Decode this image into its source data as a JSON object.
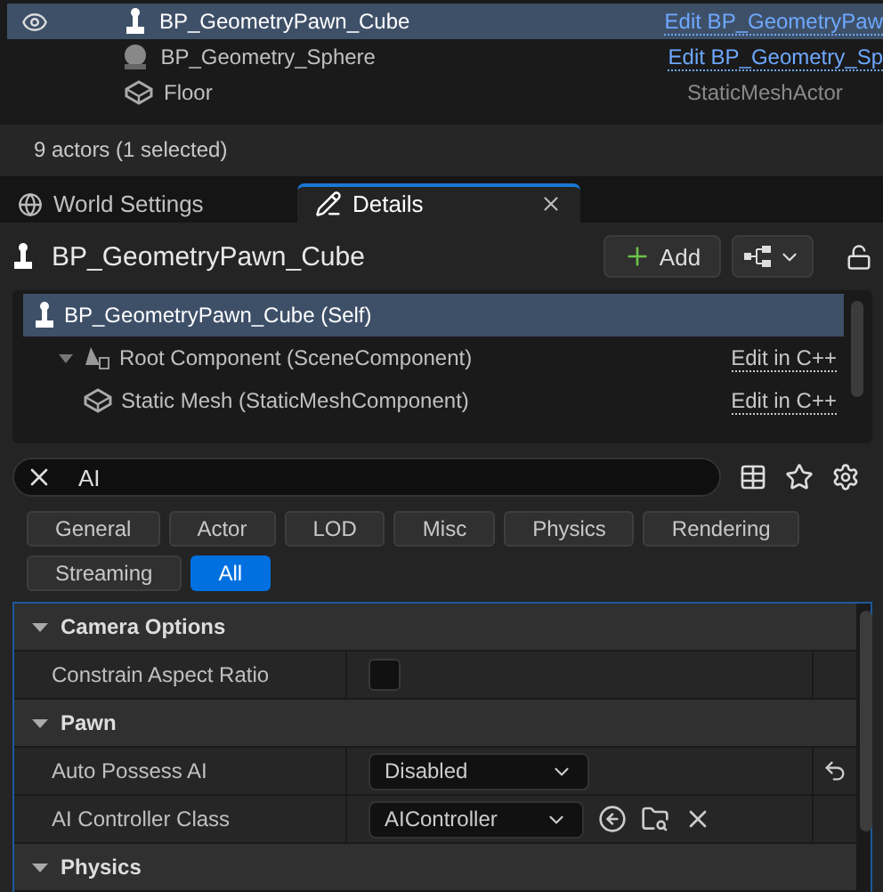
{
  "outliner": {
    "rows": [
      {
        "name": "BP_GeometryPawn_Cube",
        "kind": "pawn",
        "eye": true,
        "selected": true,
        "type_label": "Edit BP_GeometryPaw",
        "type_is_link": true
      },
      {
        "name": "BP_Geometry_Sphere",
        "kind": "sphere",
        "eye": false,
        "selected": false,
        "type_label": "Edit BP_Geometry_Sp",
        "type_is_link": true
      },
      {
        "name": "Floor",
        "kind": "mesh",
        "eye": false,
        "selected": false,
        "type_label": "StaticMeshActor",
        "type_is_link": false
      }
    ],
    "status": "9 actors (1 selected)"
  },
  "tabs": [
    {
      "label": "World Settings",
      "kind": "world",
      "selected": false
    },
    {
      "label": "Details",
      "kind": "details",
      "selected": true
    }
  ],
  "details": {
    "title": "BP_GeometryPawn_Cube",
    "add_button": "Add",
    "components": [
      {
        "label": "BP_GeometryPawn_Cube (Self)",
        "kind": "pawn",
        "selected": true,
        "children": [
          {
            "label": "Root Component (SceneComponent)",
            "kind": "scene",
            "selected": false,
            "expanded": true,
            "edit": "Edit in C++",
            "children": [
              {
                "label": "Static Mesh (StaticMeshComponent)",
                "kind": "mesh",
                "selected": false,
                "edit": "Edit in C++"
              }
            ]
          }
        ]
      }
    ],
    "search": {
      "value": "AI"
    },
    "filters": [
      {
        "label": "General",
        "selected": false
      },
      {
        "label": "Actor",
        "selected": false
      },
      {
        "label": "LOD",
        "selected": false
      },
      {
        "label": "Misc",
        "selected": false
      },
      {
        "label": "Physics",
        "selected": false
      },
      {
        "label": "Rendering",
        "selected": false
      },
      {
        "label": "Streaming",
        "selected": false
      },
      {
        "label": "All",
        "selected": true
      }
    ],
    "categories": [
      {
        "title": "Camera Options",
        "expanded": true,
        "properties": [
          {
            "label": "Constrain Aspect Ratio",
            "kind": "checkbox",
            "checked": false
          }
        ]
      },
      {
        "title": "Pawn",
        "expanded": true,
        "properties": [
          {
            "label": "Auto Possess AI",
            "kind": "dropdown",
            "value": "Disabled",
            "resettable": true
          },
          {
            "label": "AI Controller Class",
            "kind": "class_picker",
            "value": "AIController",
            "resettable": false
          }
        ]
      },
      {
        "title": "Physics",
        "expanded": true
      }
    ]
  }
}
